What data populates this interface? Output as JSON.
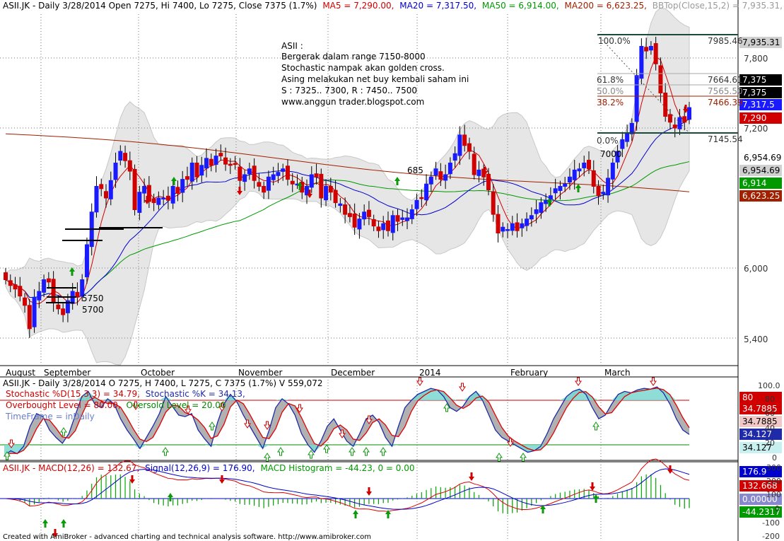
{
  "colors": {
    "up": "#1a1aff",
    "down": "#d00000",
    "ma5": "#d00000",
    "ma20": "#0000cc",
    "ma50": "#009900",
    "ma200": "#a02000",
    "band": "#e6e6e6",
    "grid": "#7a7a7a",
    "stoch_k": "#1e2aa8",
    "stoch_d": "#e00000",
    "stoch_fill": "#7ad7cf",
    "stoch_gray": "#a8a8a8",
    "ob": "#cc0000",
    "os": "#008800",
    "macd": "#0000cc",
    "signal": "#dd0000",
    "hist": "#00aa00"
  },
  "header": {
    "symbol_line": "ASII.JK - Daily 3/28/2014 Open 7275, Hi 7400, Lo 7275, Close 7375 (1.7%)",
    "ma5": "MA5 = 7,290.00,",
    "ma20": "MA20 = 7,317.50,",
    "ma50": "MA50 = 6,914.00,",
    "ma200": "MA200 = 6,623.25,",
    "bb": "BBTop(Close,15,2) = 7,935.31, BBBot(C"
  },
  "annotation": {
    "lines": [
      "ASII :",
      "Bergerak dalam range 7150-8000",
      "Stochastic nampak akan golden cross.",
      "Asing melakukan net buy kembali saham ini",
      "S : 7325.. 7300, R : 7450.. 7500",
      "www.anggun trader.blogspot.com"
    ]
  },
  "fib": {
    "labels_left": [
      "100.0%",
      "61.8%",
      "50.0%",
      "38.2%",
      "0.0%"
    ],
    "labels_right": [
      "7985.46",
      "7664.61",
      "7565.50",
      "7466.39",
      "7145.54"
    ]
  },
  "price_axis": {
    "ticks": [
      "7,800",
      "7,200",
      "6,000",
      "5,400"
    ],
    "badges": [
      "7,935.31",
      "7,375",
      "7,375",
      "7,317.5",
      "7,290",
      "6,954.69",
      "6,954.69",
      "6,914",
      "6,623.25"
    ]
  },
  "inline_labels": [
    "5750",
    "5700",
    "7000",
    "685"
  ],
  "months": [
    "August",
    "September",
    "October",
    "November",
    "December",
    "2014",
    "February",
    "March"
  ],
  "stoch": {
    "title": "ASII.JK - Daily 3/28/2014 O 7275, H 7400, L 7275, C 7375 (1.7%) V 559,072",
    "line2_a": "Stochastic %D(15,3,3) = 34.79,",
    "line2_b": "Stochastic %K = 34.13,",
    "line3_a": "Overbought Level = 80.00,",
    "line3_b": "Oversold Level = 20.00",
    "line4": "TimeFrame = inDaily",
    "axis_ticks": [
      "100.0",
      "80",
      "60",
      "40",
      "20",
      "0"
    ],
    "badges": [
      "80",
      "34.7885",
      "34.7885",
      "34.127",
      "34.127"
    ]
  },
  "macd": {
    "title_a": "ASII.JK - MACD(12,26) = 132.67,",
    "title_b": "Signal(12,26,9) = 176.90,",
    "title_c": "MACD Histogram = -44.23, 0 = 0.00",
    "axis_ticks": [
      "300",
      "200",
      "100",
      "0",
      "-100",
      "-200"
    ],
    "badges": [
      "176.9",
      "132.668",
      "0.00000",
      "-44.2317"
    ]
  },
  "footer": "Created with AmiBroker - advanced charting and technical analysis software. http://www.amibroker.com",
  "chart_data": {
    "type": "candlestick",
    "title": "ASII.JK - Daily 3/28/2014 Open 7275, Hi 7400, Lo 7275, Close 7375 (1.7%)",
    "ylim": [
      5200,
      8200
    ],
    "yticks": [
      5400,
      6000,
      7200,
      7800
    ],
    "months": [
      "August",
      "September",
      "October",
      "November",
      "December",
      "2014",
      "February",
      "March"
    ],
    "close": [
      5900,
      5850,
      5820,
      5760,
      5680,
      5480,
      5750,
      5800,
      5900,
      5880,
      5700,
      5650,
      5600,
      5720,
      5800,
      5750,
      5900,
      6200,
      6480,
      6700,
      6680,
      6600,
      6750,
      6900,
      7000,
      6920,
      6830,
      6500,
      6650,
      6700,
      6570,
      6560,
      6600,
      6600,
      6580,
      6700,
      6640,
      6760,
      6760,
      6900,
      6780,
      6880,
      6940,
      6880,
      6960,
      6960,
      6890,
      6880,
      6890,
      6750,
      6800,
      6850,
      6750,
      6700,
      6650,
      6780,
      6800,
      6820,
      6850,
      6760,
      6720,
      6720,
      6650,
      6700,
      6800,
      6780,
      6600,
      6700,
      6650,
      6560,
      6550,
      6460,
      6440,
      6350,
      6420,
      6480,
      6440,
      6360,
      6320,
      6380,
      6320,
      6450,
      6400,
      6430,
      6430,
      6500,
      6580,
      6600,
      6720,
      6780,
      6850,
      6760,
      6800,
      6900,
      6980,
      7140,
      7050,
      7000,
      6800,
      6840,
      6780,
      6670,
      6460,
      6300,
      6350,
      6330,
      6380,
      6320,
      6380,
      6420,
      6450,
      6500,
      6560,
      6580,
      6620,
      6680,
      6700,
      6720,
      6780,
      6840,
      6850,
      6900,
      6850,
      6700,
      6620,
      6650,
      6770,
      6900,
      7000,
      7100,
      7150,
      7240,
      7650,
      7900,
      7860,
      7900,
      7750,
      7500,
      7300,
      7250,
      7200,
      7290,
      7250,
      7375
    ],
    "ma5_last": 7290,
    "ma20_last": 7317.5,
    "ma50_last": 6914,
    "ma200_last": 6623.25,
    "bbtop_last": 7935.31,
    "bbbot_last": 6954.69,
    "fib_levels": [
      {
        "pct": "100.0%",
        "value": 7985.46
      },
      {
        "pct": "61.8%",
        "value": 7664.61
      },
      {
        "pct": "50.0%",
        "value": 7565.5
      },
      {
        "pct": "38.2%",
        "value": 7466.39
      },
      {
        "pct": "0.0%",
        "value": 7145.54
      }
    ],
    "stochastic": {
      "d_last": 34.79,
      "k_last": 34.13,
      "overbought": 80,
      "oversold": 20,
      "k": [
        5,
        12,
        8,
        18,
        45,
        62,
        58,
        40,
        30,
        22,
        35,
        60,
        85,
        92,
        75,
        70,
        82,
        75,
        55,
        40,
        28,
        15,
        30,
        45,
        62,
        85,
        72,
        60,
        58,
        62,
        40,
        28,
        18,
        50,
        75,
        88,
        78,
        60,
        45,
        30,
        15,
        40,
        70,
        82,
        75,
        60,
        35,
        20,
        10,
        25,
        45,
        55,
        40,
        25,
        18,
        35,
        55,
        60,
        50,
        30,
        18,
        45,
        70,
        80,
        88,
        92,
        96,
        94,
        85,
        70,
        65,
        72,
        85,
        92,
        80,
        60,
        40,
        30,
        25,
        20,
        15,
        10,
        12,
        18,
        35,
        55,
        70,
        85,
        92,
        95,
        88,
        70,
        55,
        60,
        75,
        88,
        92,
        90,
        94,
        96,
        95,
        98,
        90,
        75,
        55,
        40,
        34
      ]
    },
    "macd": {
      "macd_last": 132.67,
      "signal_last": 176.9,
      "hist_last": -44.23
    }
  }
}
